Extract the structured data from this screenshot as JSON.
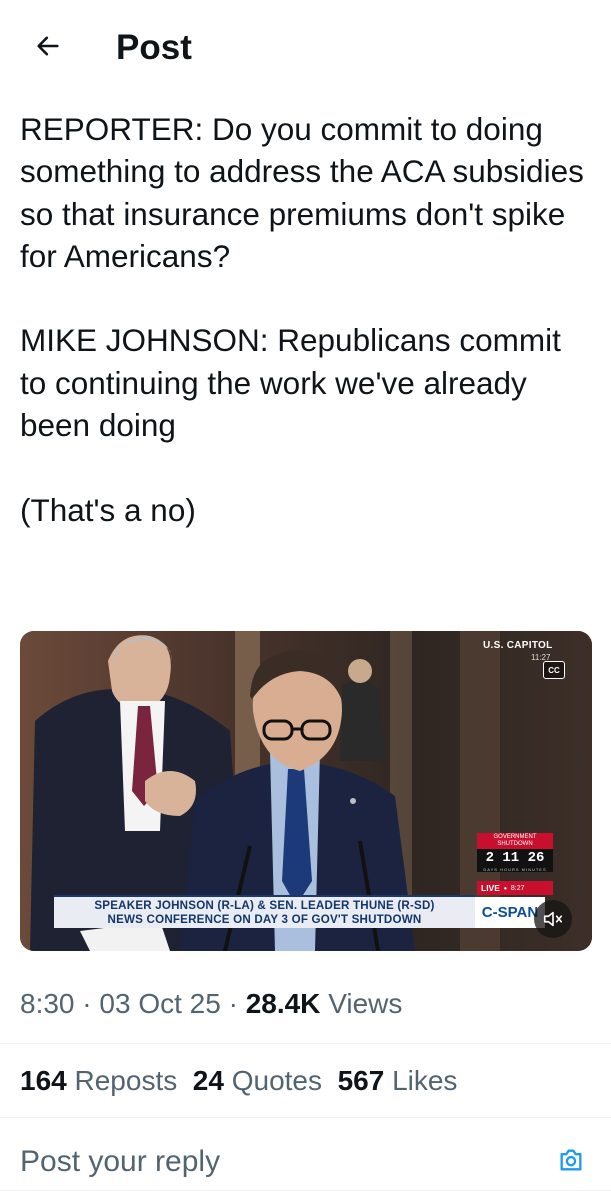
{
  "header": {
    "title": "Post",
    "back_icon": "arrow-left-icon"
  },
  "post": {
    "text": "REPORTER: Do you commit to doing something to address the ACA subsidies so that insurance premiums don't spike for Americans?\n\nMIKE JOHNSON: Republicans commit to continuing the work we've already been doing\n\n(That's a no)"
  },
  "video": {
    "location": "U.S. CAPITOL",
    "location_time": "11:27",
    "cc_label": "CC",
    "shutdown_label": "GOVERNMENT SHUTDOWN",
    "shutdown_count": "2 11 26",
    "shutdown_units": "DAYS HOURS MINUTES",
    "live_label": "LIVE",
    "live_time": "8:27",
    "chyron_line1": "SPEAKER JOHNSON (R-LA) & SEN. LEADER THUNE (R-SD)",
    "chyron_line2": "NEWS CONFERENCE ON DAY 3 OF GOV'T SHUTDOWN",
    "network": "C-SPAN",
    "mute_icon": "speaker-muted-icon"
  },
  "meta": {
    "time": "8:30",
    "date": "03 Oct 25",
    "views_count": "28.4K",
    "views_label": "Views",
    "separator": "·"
  },
  "stats": {
    "reposts_count": "164",
    "reposts_label": "Reposts",
    "quotes_count": "24",
    "quotes_label": "Quotes",
    "likes_count": "567",
    "likes_label": "Likes"
  },
  "reply": {
    "placeholder": "Post your reply",
    "camera_icon": "camera-icon"
  },
  "colors": {
    "text_primary": "#0f1419",
    "text_secondary": "#536471",
    "accent": "#1d9bf0",
    "divider": "#eff3f4"
  }
}
